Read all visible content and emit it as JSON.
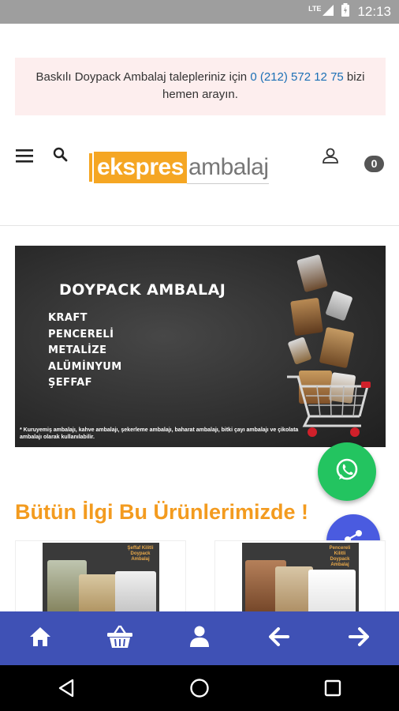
{
  "status_bar": {
    "network": "LTE",
    "time": "12:13"
  },
  "notice": {
    "text_before": "Baskılı Doypack Ambalaj talepleriniz için ",
    "phone": "0 (212) 572 12 75",
    "text_after": " bizi hemen arayın."
  },
  "header": {
    "logo_left": "ekspres",
    "logo_right": "ambalaj",
    "cart_count": "0",
    "icons": [
      "menu-icon",
      "search-icon",
      "user-icon"
    ]
  },
  "hero": {
    "title": "DOYPACK AMBALAJ",
    "items": [
      "KRAFT",
      "PENCERELİ",
      "METALİZE",
      "ALÜMİNYUM",
      "ŞEFFAF"
    ],
    "note": "* Kuruyemiş ambalajı, kahve ambalajı, şekerleme ambalajı, baharat ambalajı, bitki çayı ambalajı ve çikolata ambalajı olarak kullanılabilir."
  },
  "section": {
    "title": "Bütün İlgi Bu Ürünlerimizde !"
  },
  "products": [
    {
      "tag": "Şeffaf Kilitli Doypack Ambalaj"
    },
    {
      "tag": "Pencereli Kilitli Doypack Ambalaj"
    }
  ],
  "bottom_nav": [
    "home-icon",
    "basket-icon",
    "profile-icon",
    "arrow-left-icon",
    "arrow-right-icon"
  ],
  "colors": {
    "accent": "#f39b1f",
    "nav": "#3f51b5",
    "whatsapp": "#23c460",
    "share": "#4a5be0"
  }
}
